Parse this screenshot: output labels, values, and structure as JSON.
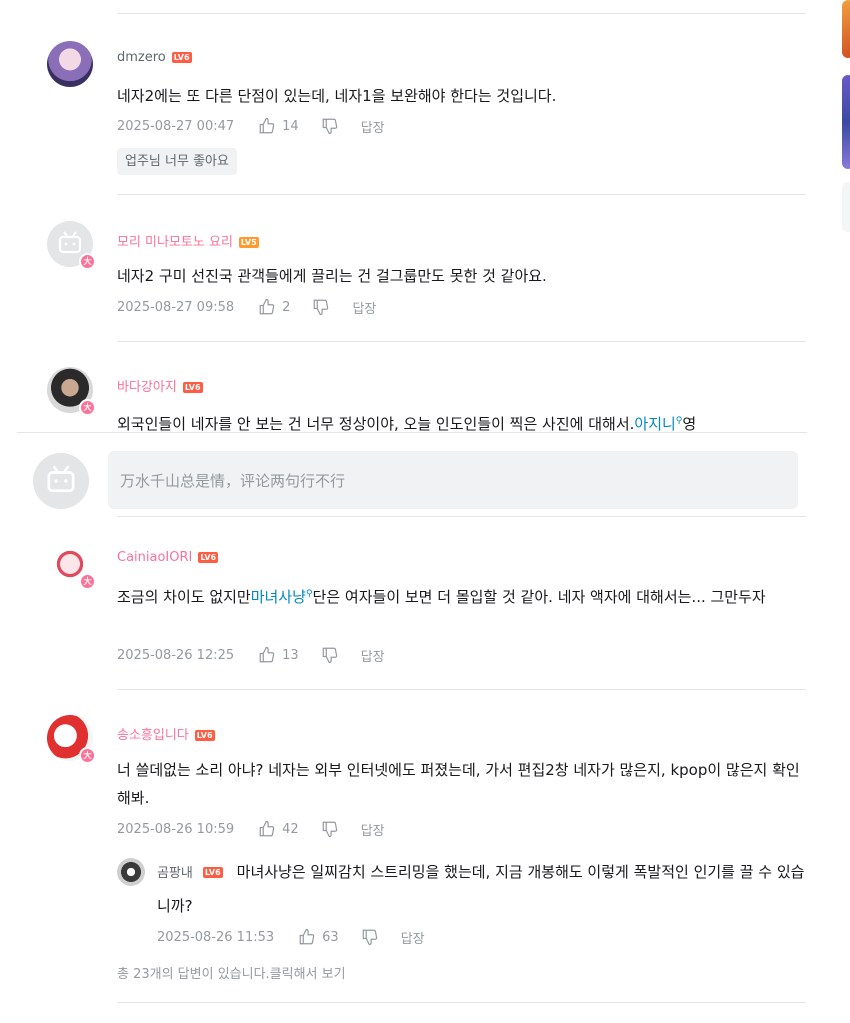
{
  "editor": {
    "placeholder": "万水千山总是情，评论两句行不行"
  },
  "comments": [
    {
      "username": "dmzero",
      "level": "LV6",
      "text": "네자2에는 또 다른 단점이 있는데, 네자1을 보완해야 한다는 것입니다.",
      "time": "2025-08-27 00:47",
      "likes": "14",
      "reply_label": "답장",
      "tag": "업주님 너무 좋아요"
    },
    {
      "username": "모리 미나모토노 요리",
      "level": "LV5",
      "text": "네자2 구미 선진국 관객들에게 끌리는 건 걸그룹만도 못한 것 같아요.",
      "time": "2025-08-27 09:58",
      "likes": "2",
      "reply_label": "답장"
    },
    {
      "username": "바다강아지",
      "level": "LV6",
      "text_before": "외국인들이 네자를 안 보는 건 너무 정상이야, 오늘 인도인들이 찍은 사진에 대해서.",
      "link": "아지니",
      "text_after": "영"
    },
    {
      "username": "CainiaoIORI",
      "level": "LV6",
      "text_before": "조금의 차이도 없지만",
      "link": "마녀사냥",
      "text_after": "단은 여자들이 보면 더 몰입할 것 같아. 네자 액자에 대해서는... 그만두자",
      "time": "2025-08-26 12:25",
      "likes": "13",
      "reply_label": "답장"
    },
    {
      "username": "송소흥입니다",
      "level": "LV6",
      "text": "너 쓸데없는 소리 아냐? 네자는 외부 인터넷에도 퍼졌는데, 가서 편집2창 네자가 많은지, kpop이 많은지 확인해봐.",
      "time": "2025-08-26 10:59",
      "likes": "42",
      "reply_label": "답장",
      "sub_reply": {
        "username": "곰팡내",
        "level": "LV6",
        "text": "마녀사냥은 일찌감치 스트리밍을 했는데, 지금 개봉해도 이렇게 폭발적인 인기를 끌 수 있습니까?",
        "time": "2025-08-26 11:53",
        "likes": "63",
        "reply_label": "답장"
      },
      "more_text": "총 23개의 답변이 있습니다.클릭해서 보기"
    }
  ],
  "colors": {
    "vip_name": "#fb7299",
    "link": "#008ac5",
    "level_badge": "#ff5c44"
  }
}
